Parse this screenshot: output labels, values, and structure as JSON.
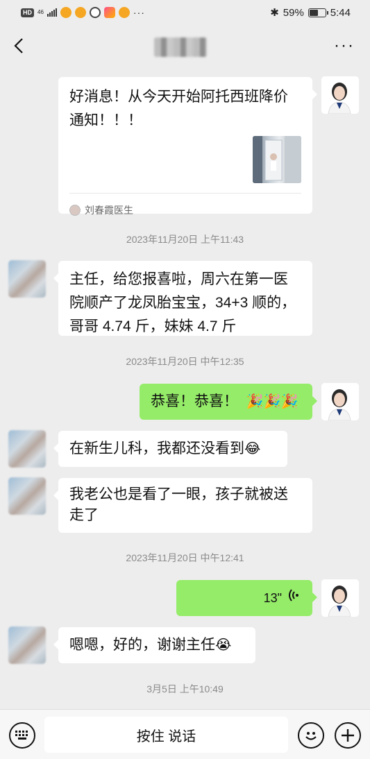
{
  "status_bar": {
    "left_hd": "HD",
    "left_net": "46",
    "left_more": "···",
    "battery_percent": "59%",
    "battery_level": 0.59,
    "time": "5:44"
  },
  "header": {
    "back_icon": "chevron-left-icon",
    "more_icon": "more-dots-icon"
  },
  "messages": {
    "card": {
      "text": "好消息！从今天开始阿托西班降价通知！！！",
      "source": "刘春霞医生"
    },
    "ts1": "2023年11月20日 上午11:43",
    "msg1": "主任，给您报喜啦，周六在第一医院顺产了龙凤胎宝宝，34+3 顺的，哥哥 4.74 斤，妹妹 4.7 斤",
    "ts2": "2023年11月20日 中午12:35",
    "msg2": "恭喜！恭喜！",
    "msg2_emoji": "🎉🎉🎉",
    "msg3": "在新生儿科，我都还没看到",
    "msg3_emoji": "😂",
    "msg4": "我老公也是看了一眼，孩子就被送走了",
    "ts3": "2023年11月20日 中午12:41",
    "voice_duration": "13\"",
    "msg5": "嗯嗯，好的，谢谢主任",
    "msg5_emoji": "😭",
    "ts4": "3月5日 上午10:49"
  },
  "bottom_bar": {
    "talk_label": "按住 说话",
    "keyboard_icon": "keyboard-icon",
    "emoji_icon": "emoji-icon",
    "plus_icon": "plus-icon"
  },
  "colors": {
    "green_bubble": "#95ec69",
    "background": "#ededed"
  }
}
